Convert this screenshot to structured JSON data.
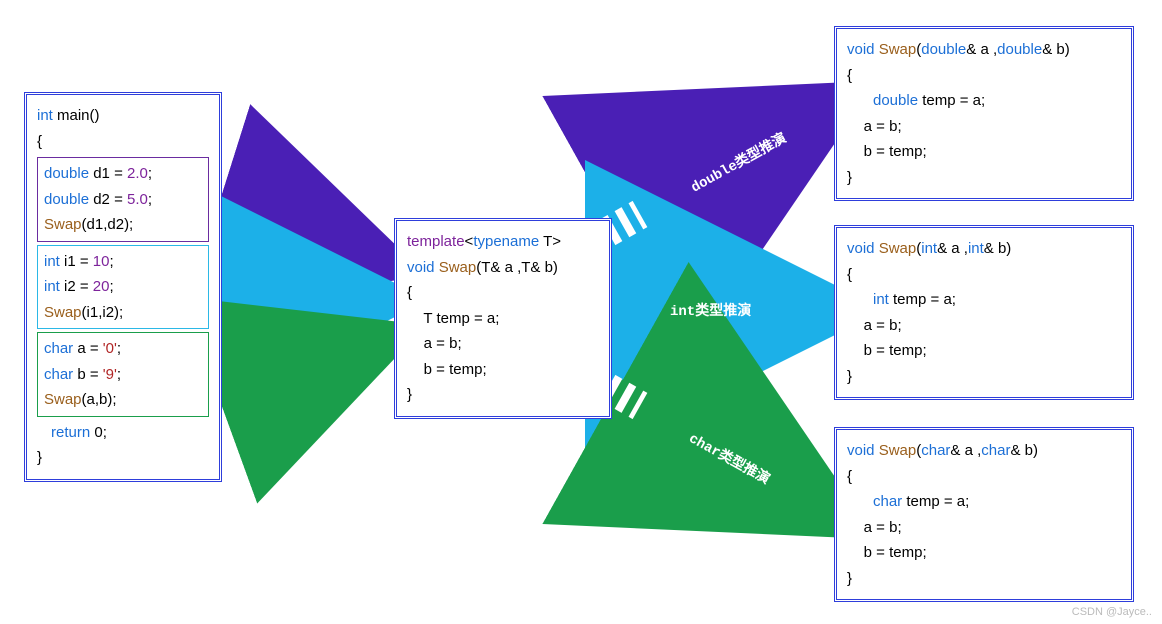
{
  "main_box": {
    "sig_kw": "int",
    "sig_fn": "main",
    "sig_paren": "()",
    "open_brace": "{",
    "close_brace": "}",
    "block_double": {
      "l1_kw": "double",
      "l1_rest": " d1 = ",
      "l1_num": "2.0",
      "l1_semi": ";",
      "l2_kw": "double",
      "l2_rest": " d2 = ",
      "l2_num": "5.0",
      "l2_semi": ";",
      "l3_fn": "Swap",
      "l3_args": "(d1,d2);"
    },
    "block_int": {
      "l1_kw": "int",
      "l1_rest": " i1 = ",
      "l1_num": "10",
      "l1_semi": ";",
      "l2_kw": "int",
      "l2_rest": " i2 = ",
      "l2_num": "20",
      "l2_semi": ";",
      "l3_fn": "Swap",
      "l3_args": "(i1,i2);"
    },
    "block_char": {
      "l1_kw": "char",
      "l1_rest": " a = ",
      "l1_str": "'0'",
      "l1_semi": ";",
      "l2_kw": "char",
      "l2_rest": " b = ",
      "l2_str": "'9'",
      "l2_semi": ";",
      "l3_fn": "Swap",
      "l3_args": "(a,b);"
    },
    "return_kw": "return",
    "return_val": " 0;",
    "indent": "    "
  },
  "template_box": {
    "l1_tpl": "template",
    "l1_open": "<",
    "l1_tn": "typename",
    "l1_T": " T",
    "l1_close": ">",
    "l2_kw": "void",
    "l2_fn": " Swap",
    "l2_params": "(T& a ,T& b)",
    "open_brace": "{",
    "body1_pre": "    T temp = a;",
    "body2": "    a = b;",
    "body3": "    b = temp;",
    "close_brace": "}"
  },
  "out_double": {
    "l1_kw": "void",
    "l1_fn": " Swap",
    "l1_params_a_kw": "double",
    "l1_params_mid": "& a ,",
    "l1_params_b_kw": "double",
    "l1_params_end": "& b)",
    "open_brace": "{",
    "b1_kw": "double",
    "b1_rest": " temp = a;",
    "b2": "    a = b;",
    "b3": "    b = temp;",
    "close_brace": "}"
  },
  "out_int": {
    "l1_kw": "void",
    "l1_fn": " Swap",
    "l1_params_a_kw": "int",
    "l1_params_mid": "& a ,",
    "l1_params_b_kw": "int",
    "l1_params_end": "& b)",
    "open_brace": "{",
    "b1_kw": "int",
    "b1_rest": " temp = a;",
    "b2": "    a = b;",
    "b3": "    b = temp;",
    "close_brace": "}"
  },
  "out_char": {
    "l1_kw": "void",
    "l1_fn": " Swap",
    "l1_params_a_kw": "char",
    "l1_params_mid": "& a ,",
    "l1_params_b_kw": "char",
    "l1_params_end": "& b)",
    "open_brace": "{",
    "b1_kw": "char",
    "b1_rest": " temp = a;",
    "b2": "    a = b;",
    "b3": "    b = temp;",
    "close_brace": "}"
  },
  "arrow_labels": {
    "double": "double类型推演",
    "int": "int类型推演",
    "char": "char类型推演"
  },
  "colors": {
    "purple": "#4a1fb5",
    "cyan": "#1cb0e8",
    "green": "#1a9e4b"
  },
  "watermark": "CSDN @Jayce.."
}
